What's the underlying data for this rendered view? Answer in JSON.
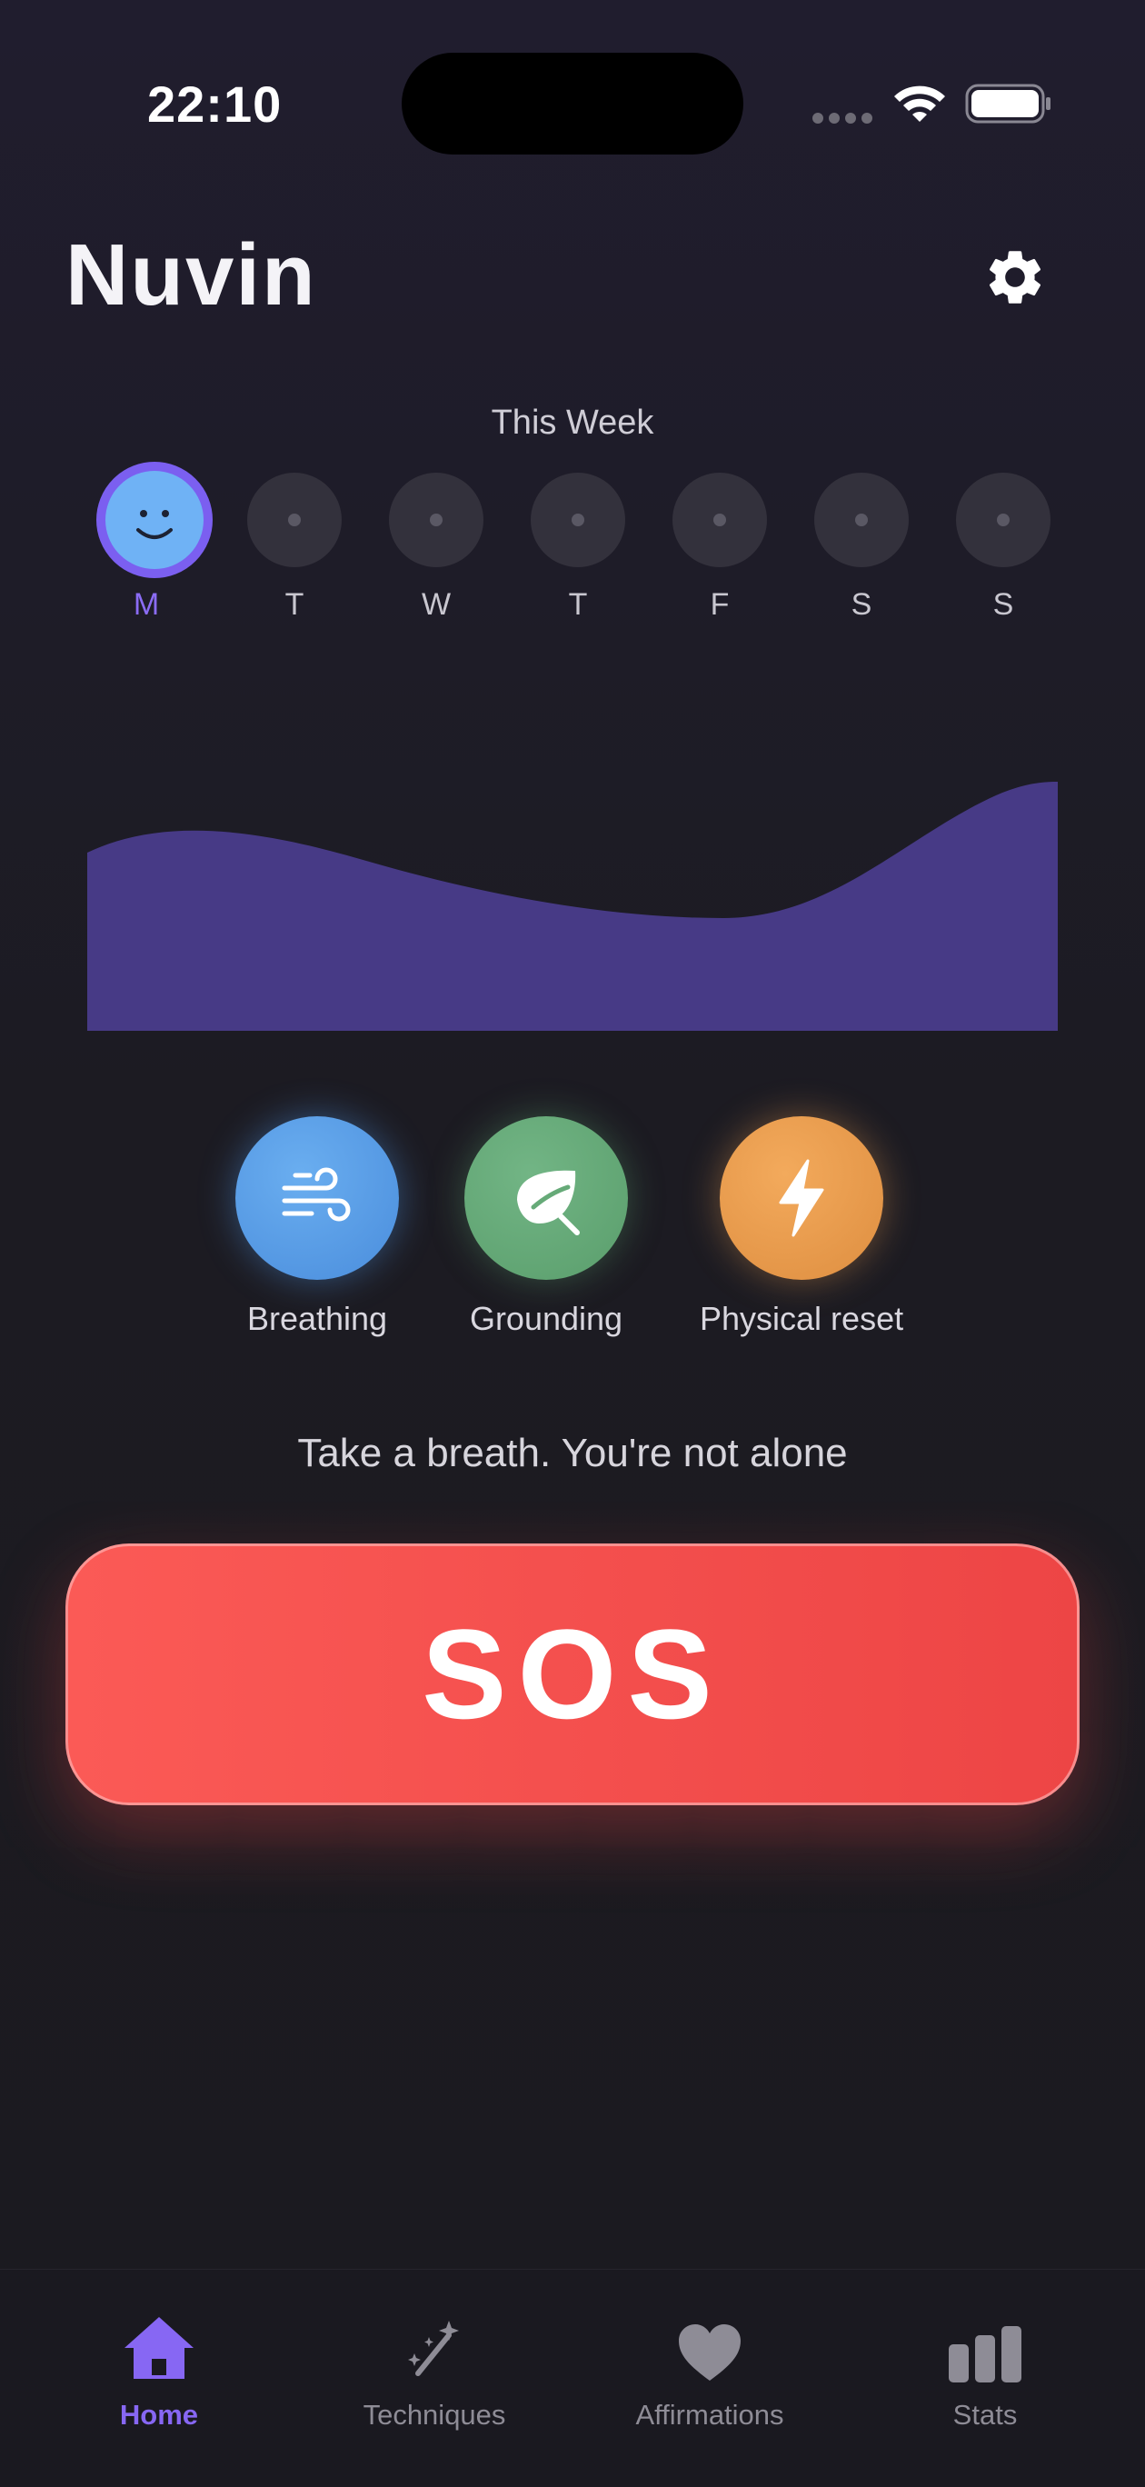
{
  "status": {
    "time": "22:10"
  },
  "header": {
    "title": "Nuvin"
  },
  "week": {
    "title": "This Week",
    "days": [
      "M",
      "T",
      "W",
      "T",
      "F",
      "S",
      "S"
    ],
    "active_index": 0
  },
  "actions": [
    {
      "label": "Breathing",
      "icon": "wind-icon"
    },
    {
      "label": "Grounding",
      "icon": "leaf-icon"
    },
    {
      "label": "Physical reset",
      "icon": "lightning-icon"
    }
  ],
  "tagline": "Take a breath. You're not alone",
  "sos": {
    "label": "SOS"
  },
  "tabs": [
    {
      "label": "Home",
      "icon": "home-icon",
      "active": true
    },
    {
      "label": "Techniques",
      "icon": "magic-wand-icon"
    },
    {
      "label": "Affirmations",
      "icon": "heart-icon"
    },
    {
      "label": "Stats",
      "icon": "bar-chart-icon"
    }
  ],
  "colors": {
    "accent": "#8767f3",
    "sos": "#f04a4a",
    "breathing": "#5b9de6",
    "grounding": "#66aa78",
    "physical_reset": "#eb9c4e",
    "mood_wave": "#473a86"
  }
}
